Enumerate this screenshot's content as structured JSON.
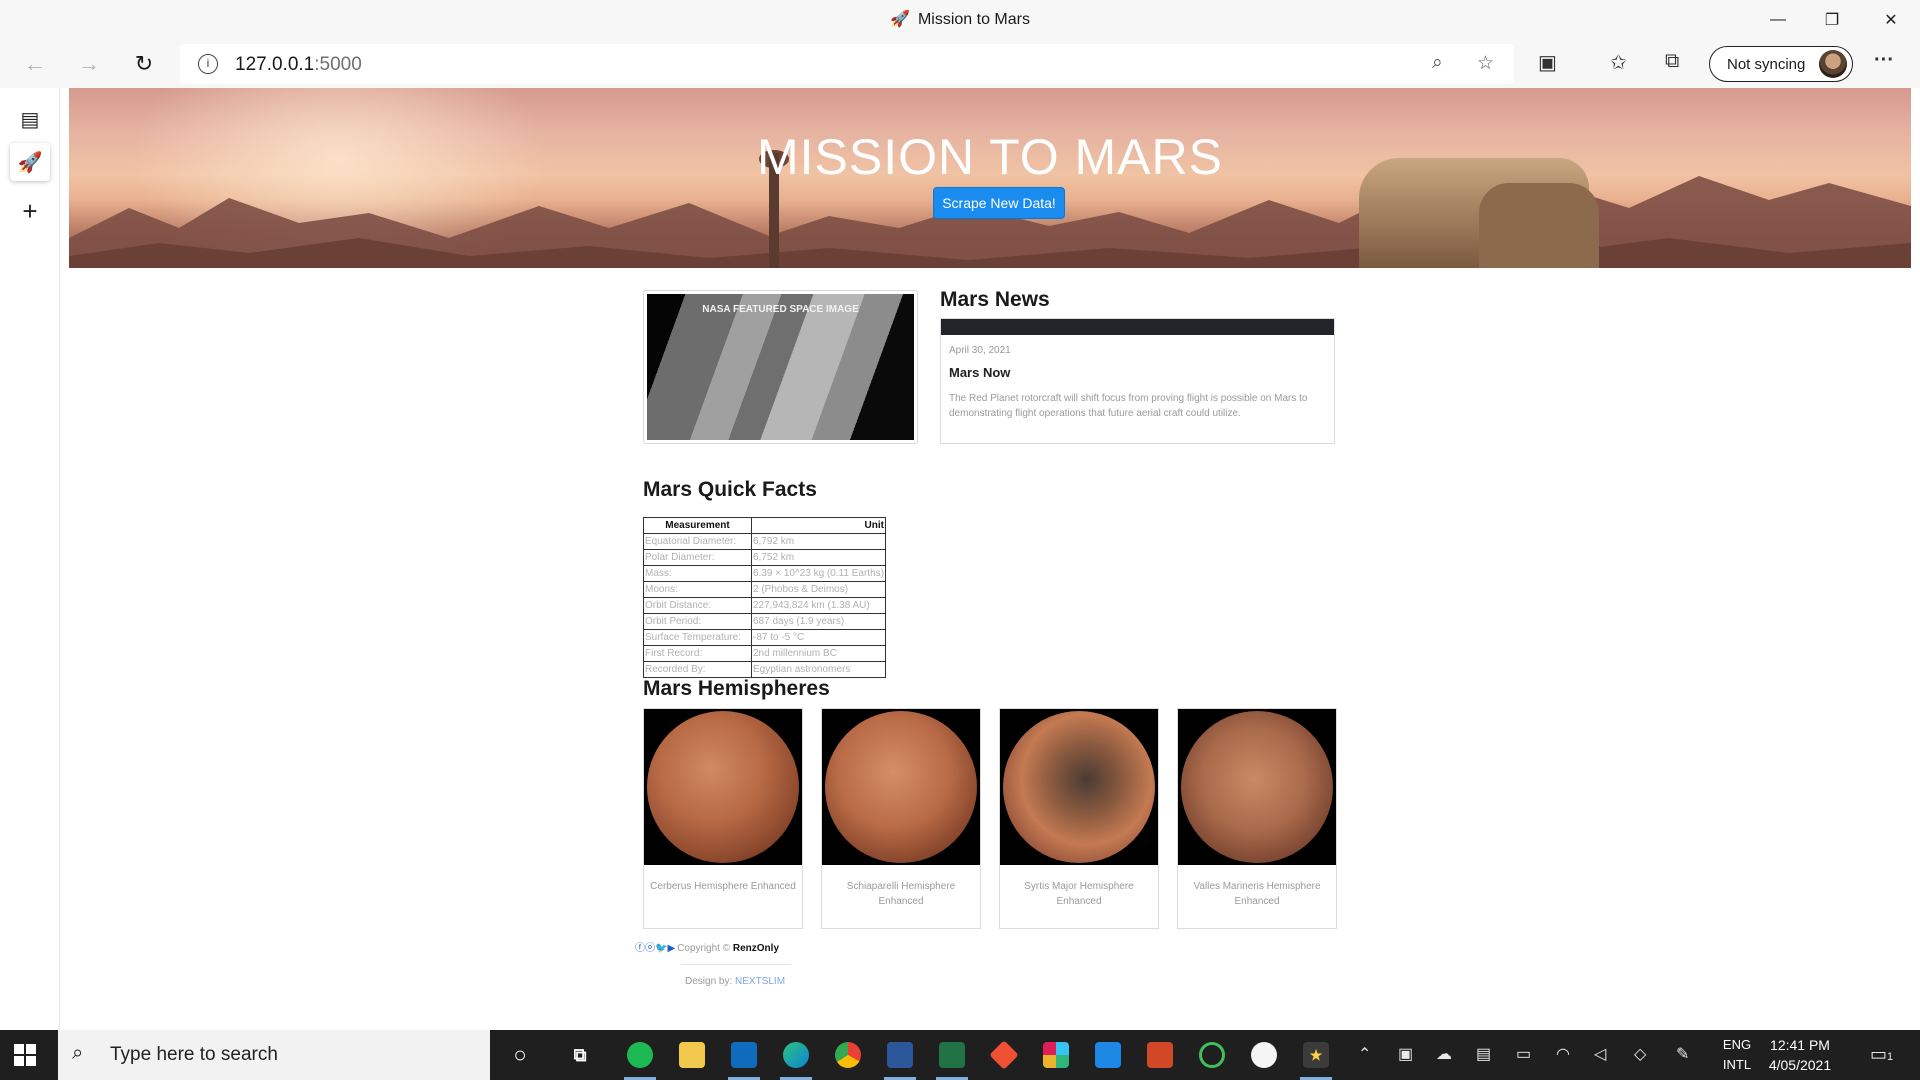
{
  "window": {
    "title": "Mission to Mars",
    "controls": {
      "minimize": "—",
      "restore": "❐",
      "close": "✕"
    }
  },
  "toolbar": {
    "url_host": "127.0.0.1",
    "url_port": ":5000",
    "sync_label": "Not syncing",
    "more": "···"
  },
  "icons": {
    "back": "←",
    "forward": "→",
    "refresh": "↻",
    "info": "i",
    "zoom": "⌕",
    "add_favorite": "☆",
    "extensions": "▣",
    "favorites": "✩",
    "collections": "⧉",
    "tab_actions": "▤",
    "rocket": "🚀",
    "new_tab": "+",
    "search": "⌕",
    "cortana": "○",
    "task_view": "⧉"
  },
  "header": {
    "title": "MISSION TO MARS",
    "scrape_button": "Scrape New Data!"
  },
  "featured_image": {
    "caption": "NASA FEATURED SPACE IMAGE"
  },
  "news": {
    "heading": "Mars News",
    "date": "April 30, 2021",
    "title": "Mars Now",
    "teaser": "The Red Planet rotorcraft will shift focus from proving flight is possible on Mars to demonstrating flight operations that future aerial craft could utilize."
  },
  "facts": {
    "heading": "Mars Quick Facts",
    "columns": [
      "Measurement",
      "Unit"
    ],
    "rows": [
      [
        "Equatorial Diameter:",
        "6,792 km"
      ],
      [
        "Polar Diameter:",
        "6,752 km"
      ],
      [
        "Mass:",
        "6.39 × 10^23 kg (0.11 Earths)"
      ],
      [
        "Moons:",
        "2 (Phobos & Deimos)"
      ],
      [
        "Orbit Distance:",
        "227,943,824 km (1.38 AU)"
      ],
      [
        "Orbit Period:",
        "687 days (1.9 years)"
      ],
      [
        "Surface Temperature:",
        "-87 to -5 °C"
      ],
      [
        "First Record:",
        "2nd millennium BC"
      ],
      [
        "Recorded By:",
        "Egyptian astronomers"
      ]
    ]
  },
  "hemispheres": {
    "heading": "Mars Hemispheres",
    "items": [
      {
        "title": "Cerberus Hemisphere Enhanced"
      },
      {
        "title": "Schiaparelli Hemisphere Enhanced"
      },
      {
        "title": "Syrtis Major Hemisphere Enhanced"
      },
      {
        "title": "Valles Marineris Hemisphere Enhanced"
      }
    ]
  },
  "footer": {
    "social": "ⓕⓞ🐦▶",
    "copyright": "Copyright ©",
    "author": "RenzOnly",
    "design_prefix": "Design by:",
    "design_brand": "NEXTSLIM"
  },
  "taskbar": {
    "search_placeholder": "Type here to search",
    "lang_1": "ENG",
    "lang_2": "INTL",
    "time": "12:41 PM",
    "date": "4/05/2021",
    "notifications": "1"
  },
  "colors": {
    "accent_button": "#1a8cf0",
    "news_bar": "#212529",
    "taskbar": "#1f1f1f"
  }
}
